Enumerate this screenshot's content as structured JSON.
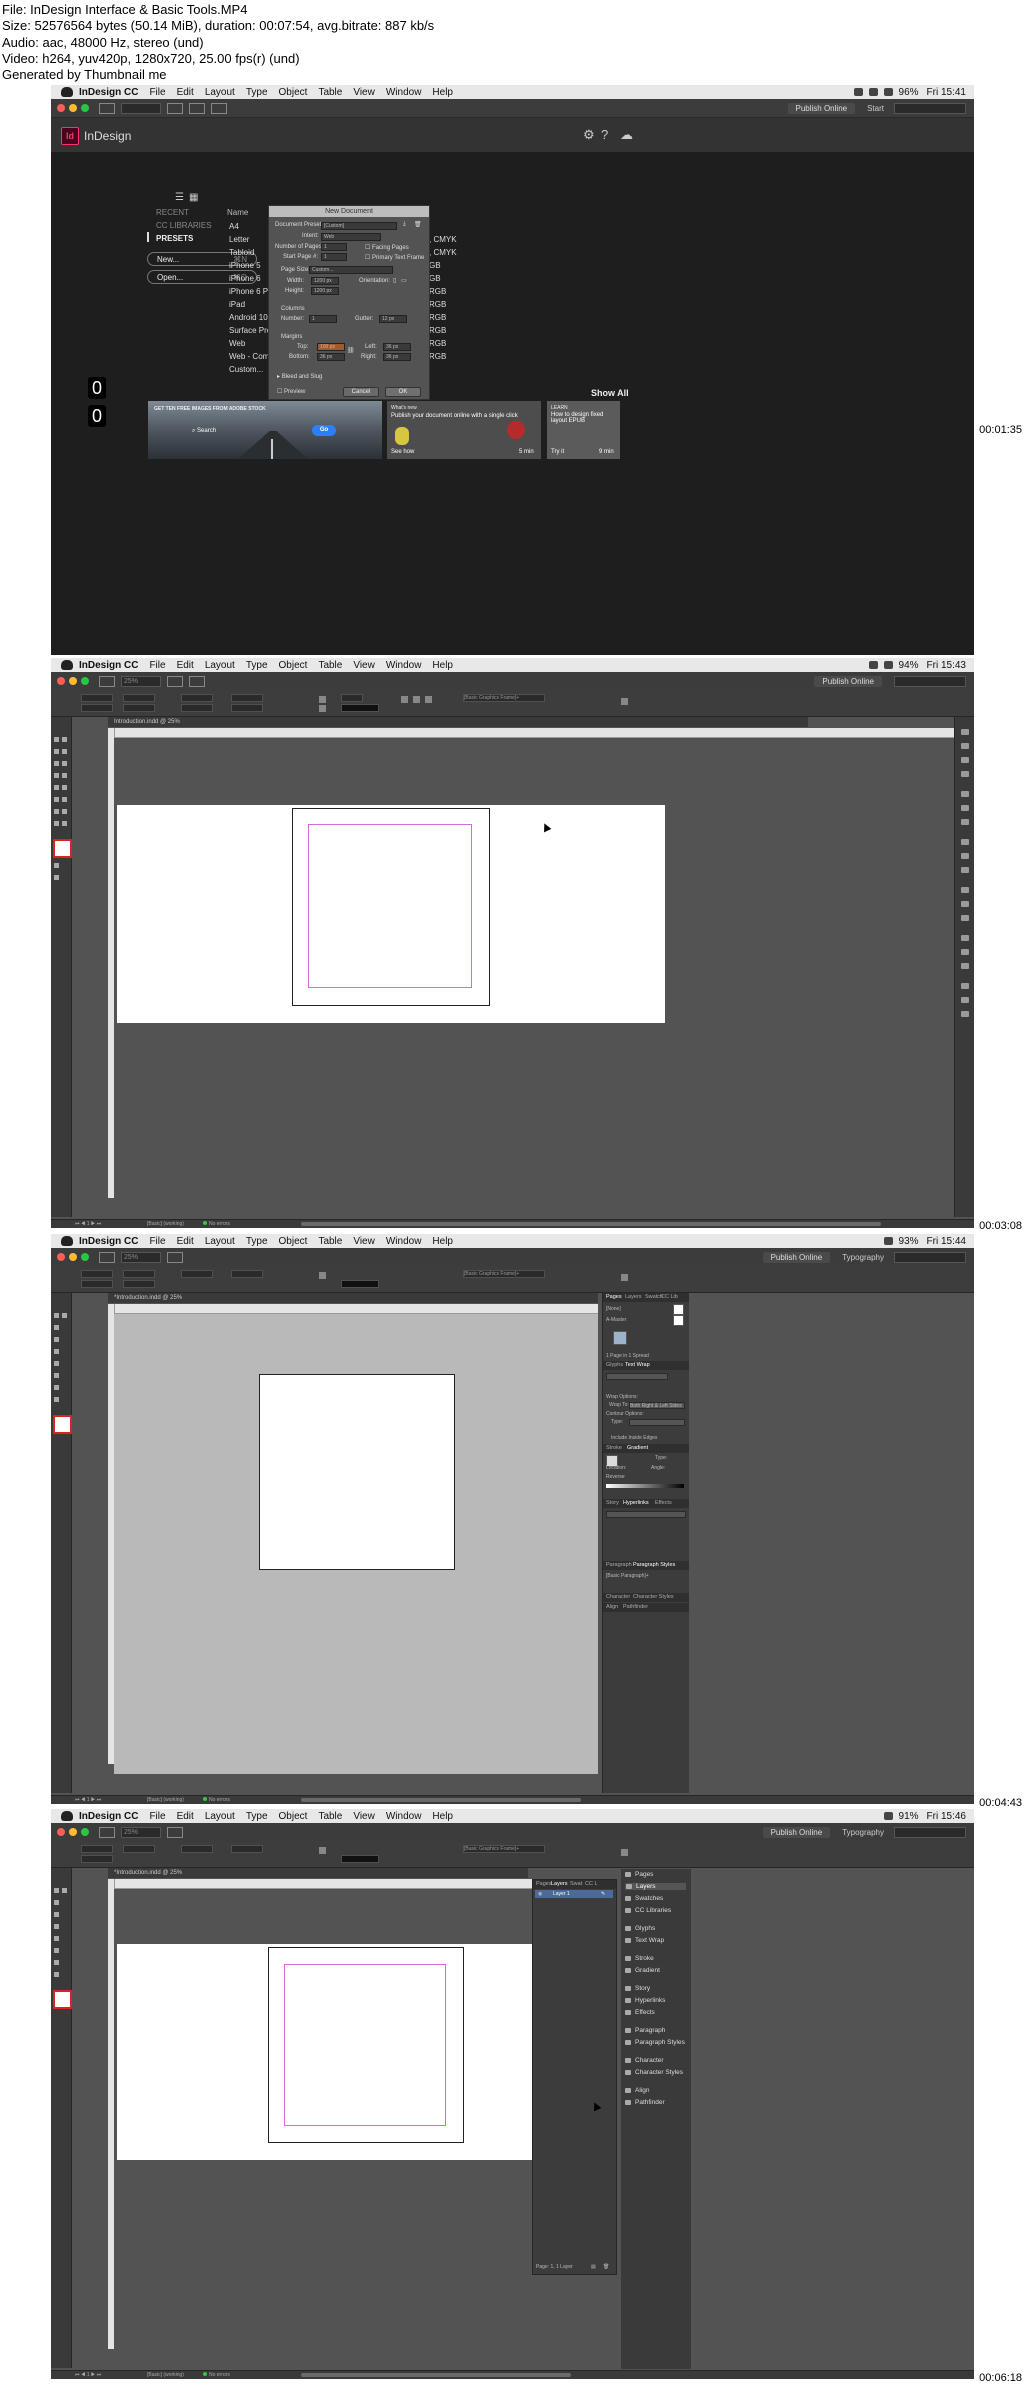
{
  "header": {
    "lines": [
      "File: InDesign Interface & Basic Tools.MP4",
      "Size: 52576564 bytes (50.14 MiB), duration: 00:07:54, avg.bitrate: 887 kb/s",
      "Audio: aac, 48000 Hz, stereo (und)",
      "Video: h264, yuv420p, 1280x720, 25.00 fps(r) (und)",
      "Generated by Thumbnail me"
    ]
  },
  "menubar": {
    "app": "InDesign CC",
    "items": [
      "File",
      "Edit",
      "Layout",
      "Type",
      "Object",
      "Table",
      "View",
      "Window",
      "Help"
    ]
  },
  "frames": [
    {
      "timestamp": "00:01:35",
      "clock": "Fri 15:41",
      "battery": "96%",
      "publish": "Publish Online",
      "workspace": "Start",
      "home": {
        "title": "InDesign",
        "sidebar": [
          "RECENT",
          "CC LIBRARIES",
          "PRESETS"
        ],
        "new_label": "New...",
        "new_key": "⌘N",
        "open_label": "Open...",
        "open_key": "⌘O",
        "col_name": "Name",
        "presets": [
          "A4",
          "Letter",
          "Tabloid",
          "iPhone 5",
          "iPhone 6",
          "iPhone 6 Plus",
          "iPad",
          "Android 10\"",
          "Surface Pro 3",
          "Web",
          "Web - Common",
          "Custom..."
        ],
        "right_col": [
          ", CMYK",
          ", CMYK",
          ", CMYK",
          "GB",
          "GB",
          "RGB",
          "RGB",
          "RGB",
          "RGB",
          "RGB",
          "RGB"
        ],
        "show_all": "Show All",
        "card1": {
          "caption": "GET TEN FREE IMAGES FROM ADOBE STOCK",
          "search": "Search",
          "go": "Go"
        },
        "card2": {
          "tag": "What's new",
          "title": "Publish your document online with a single click",
          "link": "See how",
          "duration": "5 min"
        },
        "card3": {
          "tag": "LEARN",
          "title": "How to design fixed layout EPUB",
          "link": "Try it",
          "duration": "9 min"
        },
        "counters": [
          "0",
          "0"
        ]
      },
      "dialog": {
        "title": "New Document",
        "preset_label": "Document Preset:",
        "preset_value": "[Custom]",
        "intent_label": "Intent:",
        "intent_value": "Web",
        "pages_label": "Number of Pages:",
        "pages_value": "1",
        "start_label": "Start Page #:",
        "start_value": "1",
        "facing": "Facing Pages",
        "primary": "Primary Text Frame",
        "size_label": "Page Size:",
        "size_value": "Custom...",
        "width_label": "Width:",
        "width_value": "1200 px",
        "height_label": "Height:",
        "height_value": "1200 px",
        "orient_label": "Orientation:",
        "columns_label": "Columns",
        "number_label": "Number:",
        "number_value": "1",
        "gutter_label": "Gutter:",
        "gutter_value": "12 px",
        "margins_label": "Margins",
        "top_label": "Top:",
        "top_value": "100 px",
        "bottom_label": "Bottom:",
        "bottom_value": "36 px",
        "left_label": "Left:",
        "left_value": "36 px",
        "right_label": "Right:",
        "right_value": "36 px",
        "bleed_label": "Bleed and Slug",
        "preview_label": "Preview",
        "cancel": "Cancel",
        "ok": "OK"
      }
    },
    {
      "timestamp": "00:03:08",
      "clock": "Fri 15:43",
      "battery": "94%",
      "publish": "Publish Online",
      "zoom": "25%",
      "doc_tab": "Introduction.indd @ 25%",
      "style": "[Basic Graphics Frame]+",
      "status_style": "[Basic] (working)",
      "errors": "No errors"
    },
    {
      "timestamp": "00:04:43",
      "clock": "Fri 15:44",
      "battery": "93%",
      "publish": "Publish Online",
      "workspace": "Typography",
      "zoom": "25%",
      "doc_tab": "*Introduction.indd @ 25%",
      "style": "[Basic Graphics Frame]+",
      "status_style": "[Basic] (working)",
      "errors": "No errors",
      "panels": {
        "pages_tabs": [
          "Pages",
          "Layers",
          "Swatch",
          "CC Lib"
        ],
        "none": "[None]",
        "a_master": "A-Master",
        "pages_footer": "1 Page in 1 Spread",
        "glyphs_tabs": [
          "Glyphs",
          "Text Wrap"
        ],
        "wrap_options": "Wrap Options:",
        "wrap_to": "Wrap To:",
        "wrap_to_value": "Both Right & Left Sides",
        "contour": "Contour Options:",
        "type_label": "Type:",
        "include_edges": "Include Inside Edges",
        "stroke_tabs": [
          "Stroke",
          "Gradient"
        ],
        "type2": "Type:",
        "location": "Location:",
        "angle": "Angle:",
        "reverse": "Reverse",
        "story_tabs": [
          "Story",
          "Hyperlinks",
          "Effects"
        ],
        "para_tabs": [
          "Paragraph",
          "Paragraph Styles"
        ],
        "basic_para": "[Basic Paragraph]+",
        "char_tabs": [
          "Character",
          "Character Styles"
        ],
        "align_tabs": [
          "Align",
          "Pathfinder"
        ]
      }
    },
    {
      "timestamp": "00:06:18",
      "clock": "Fri 15:46",
      "battery": "91%",
      "publish": "Publish Online",
      "workspace": "Typography",
      "zoom": "25%",
      "doc_tab": "*Introduction.indd @ 25%",
      "style": "[Basic Graphics Frame]+",
      "status_style": "[Basic] (working)",
      "errors": "No errors",
      "layers": {
        "tabs": [
          "Pages",
          "Layers",
          "Swat",
          "CC L"
        ],
        "layer1": "Layer 1",
        "footer": "Page: 1, 1 Layer"
      },
      "nav": [
        "Pages",
        "Layers",
        "Swatches",
        "CC Libraries",
        "Glyphs",
        "Text Wrap",
        "Stroke",
        "Gradient",
        "Story",
        "Hyperlinks",
        "Effects",
        "Paragraph",
        "Paragraph Styles",
        "Character",
        "Character Styles",
        "Align",
        "Pathfinder"
      ]
    }
  ]
}
